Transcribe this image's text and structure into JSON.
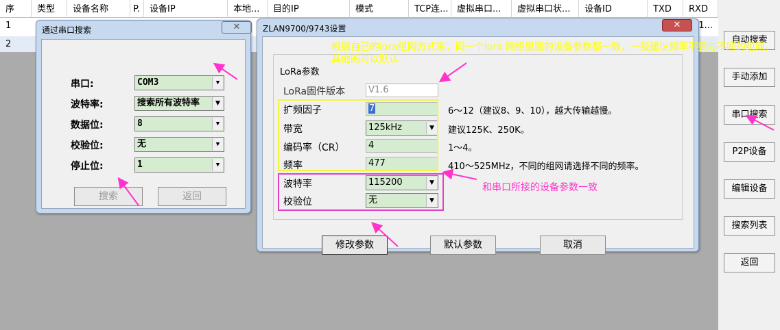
{
  "table": {
    "headers": [
      "序",
      "类型",
      "设备名称",
      "P.",
      "设备IP",
      "本地...",
      "目的IP",
      "模式",
      "TCP连...",
      "虚拟串口...",
      "虚拟串口状...",
      "设备ID",
      "TXD",
      "RXD"
    ],
    "rows": [
      {
        "no": "1",
        "rxd": "1..."
      },
      {
        "no": "2"
      }
    ]
  },
  "side_buttons": [
    "自动搜索",
    "手动添加",
    "串口搜索",
    "P2P设备",
    "编辑设备",
    "搜索列表",
    "返回"
  ],
  "serial_dialog": {
    "title": "通过串口搜索",
    "fields": [
      {
        "label": "串口:",
        "value": "COM3"
      },
      {
        "label": "波特率:",
        "value": "搜索所有波特率"
      },
      {
        "label": "数据位:",
        "value": "8"
      },
      {
        "label": "校验位:",
        "value": "无"
      },
      {
        "label": "停止位:",
        "value": "1"
      }
    ],
    "search_button": "搜索",
    "back_button": "返回"
  },
  "zlan_dialog": {
    "title": "ZLAN9700/9743设置",
    "group_label": "LoRa参数",
    "firmware": {
      "label": "LoRa固件版本",
      "value": "V1.6"
    },
    "spread": {
      "label": "扩频因子",
      "value": "7",
      "hint": "6～12（建议8、9、10），越大传输越慢。"
    },
    "bandwidth": {
      "label": "带宽",
      "value": "125kHz",
      "hint": "建议125K、250K。"
    },
    "coding_rate": {
      "label": "编码率（CR）",
      "value": "4",
      "hint": "1～4。"
    },
    "frequency": {
      "label": "频率",
      "value": "477",
      "hint": "410～525MHz，不同的组网请选择不同的频率。"
    },
    "baud": {
      "label": "波特率",
      "value": "115200"
    },
    "parity": {
      "label": "校验位",
      "value": "无"
    },
    "modify_button": "修改参数",
    "default_button": "默认参数",
    "cancel_button": "取消"
  },
  "annotations": {
    "note_lora": "根据自己的lora组网方式来，同一个lora 网络里面的设备参数都一致，一般建议频率不要与不同的组网，其他的可以默认",
    "note_serial": "和串口所接的设备参数一致"
  },
  "colors": {
    "annotation_yellow": "#ffff00",
    "annotation_magenta": "#ff33cc",
    "field_green": "#d6ecd0"
  }
}
